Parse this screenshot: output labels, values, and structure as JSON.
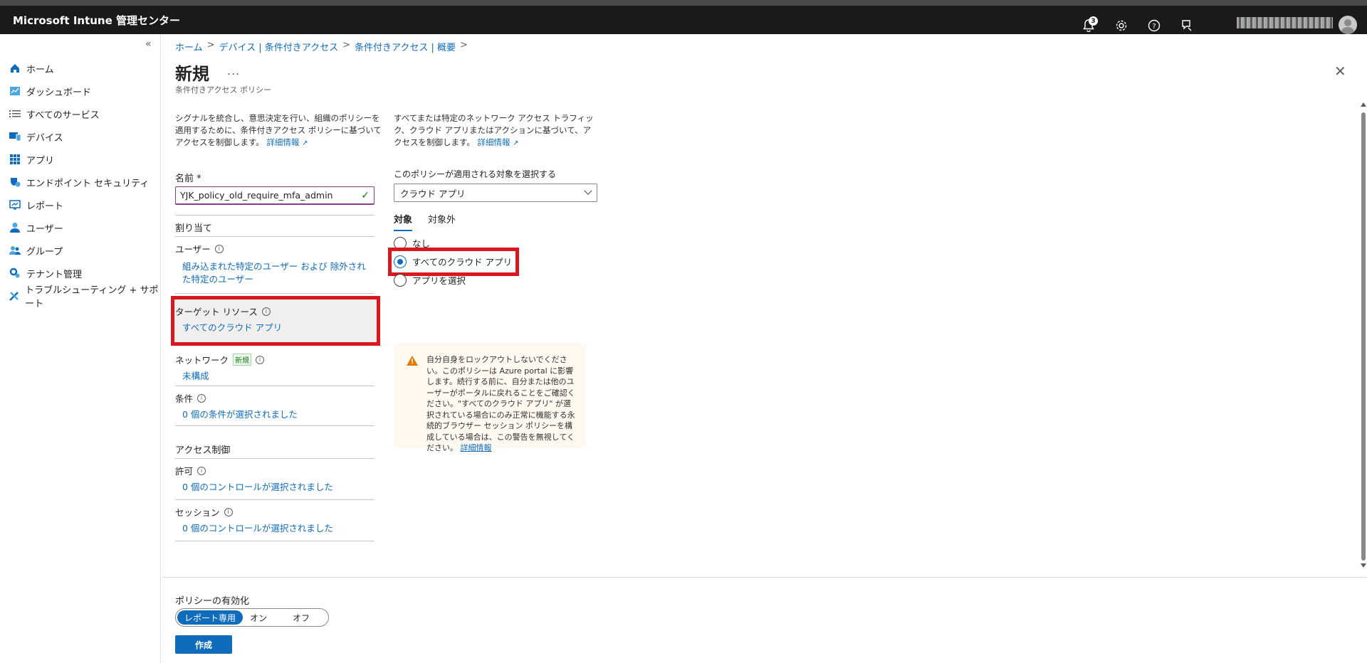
{
  "app": {
    "title": "Microsoft Intune 管理センター",
    "notification_count": "3"
  },
  "sidebar": {
    "collapse": "«",
    "items": [
      {
        "label": "ホーム",
        "icon": "home-icon"
      },
      {
        "label": "ダッシュボード",
        "icon": "dashboard-icon"
      },
      {
        "label": "すべてのサービス",
        "icon": "list-icon"
      },
      {
        "label": "デバイス",
        "icon": "devices-icon"
      },
      {
        "label": "アプリ",
        "icon": "apps-icon"
      },
      {
        "label": "エンドポイント セキュリティ",
        "icon": "shield-icon"
      },
      {
        "label": "レポート",
        "icon": "reports-icon"
      },
      {
        "label": "ユーザー",
        "icon": "user-icon"
      },
      {
        "label": "グループ",
        "icon": "group-icon"
      },
      {
        "label": "テナント管理",
        "icon": "tenant-icon"
      },
      {
        "label": "トラブルシューティング + サポート",
        "icon": "tools-icon"
      }
    ]
  },
  "breadcrumb": [
    "ホーム",
    "デバイス | 条件付きアクセス",
    "条件付きアクセス | 概要"
  ],
  "page": {
    "title": "新規",
    "more": "...",
    "subtitle": "条件付きアクセス ポリシー",
    "close": "✕"
  },
  "left": {
    "description": "シグナルを統合し、意思決定を行い、組織のポリシーを適用するために、条件付きアクセス ポリシーに基づいてアクセスを制御します。",
    "learn_more": "詳細情報",
    "name_label": "名前 *",
    "name_value": "YJK_policy_old_require_mfa_admin",
    "assignments_header": "割り当て",
    "users_label": "ユーザー",
    "users_value": "組み込まれた特定のユーザー および 除外された特定のユーザー",
    "target_label": "ターゲット リソース",
    "target_value": "すべてのクラウド アプリ",
    "network_label": "ネットワーク",
    "network_badge": "新規",
    "network_value": "未構成",
    "conditions_label": "条件",
    "conditions_value": "0 個の条件が選択されました",
    "access_header": "アクセス制御",
    "grant_label": "許可",
    "grant_value": "0 個のコントロールが選択されました",
    "session_label": "セッション",
    "session_value": "0 個のコントロールが選択されました"
  },
  "right": {
    "description": "すべてまたは特定のネットワーク アクセス トラフィック、クラウド アプリまたはアクションに基づいて、アクセスを制御します。",
    "learn_more": "詳細情報",
    "select_label": "このポリシーが適用される対象を選択する",
    "select_value": "クラウド アプリ",
    "tabs": [
      "対象",
      "対象外"
    ],
    "radio_none": "なし",
    "radio_all": "すべてのクラウド アプリ",
    "radio_select": "アプリを選択",
    "warning_text": "自分自身をロックアウトしないでください。このポリシーは Azure portal に影響します。続行する前に、自分または他のユーザーがポータルに戻れることをご確認ください。\"すべてのクラウド アプリ\" が選択されている場合にのみ正常に機能する永続的ブラウザー セッション ポリシーを構成している場合は、この警告を無視してください。",
    "warning_link": "詳細情報"
  },
  "footer": {
    "enable_label": "ポリシーの有効化",
    "options": [
      "レポート専用",
      "オン",
      "オフ"
    ],
    "create": "作成"
  },
  "colors": {
    "accent": "#0f6cbd",
    "highlight": "#d9171e",
    "topbar": "#1b1a19"
  }
}
